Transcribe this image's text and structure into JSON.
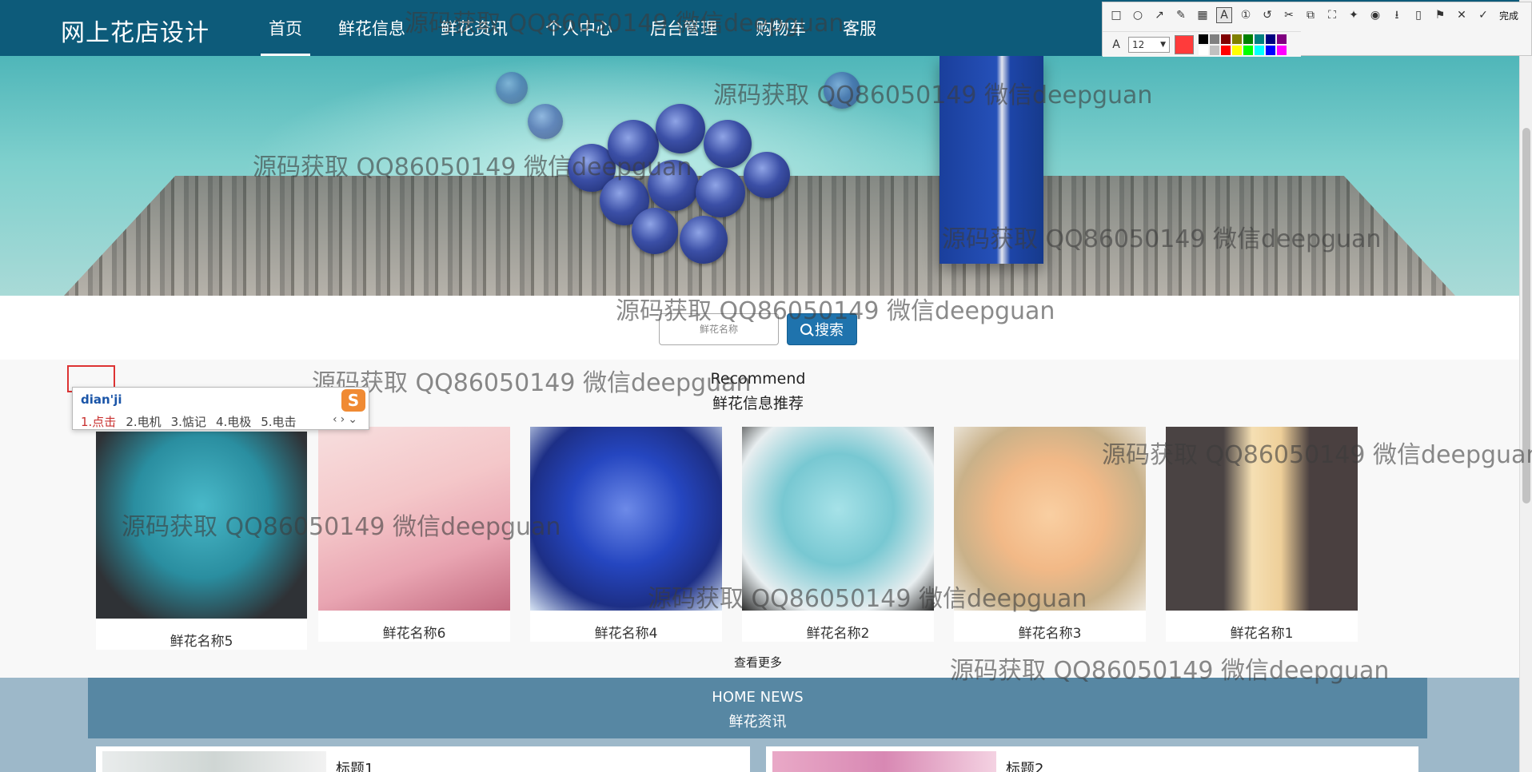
{
  "brand": "网上花店设计",
  "nav": [
    {
      "label": "首页",
      "active": true
    },
    {
      "label": "鲜花信息"
    },
    {
      "label": "鲜花资讯"
    },
    {
      "label": "个人中心"
    },
    {
      "label": "后台管理"
    },
    {
      "label": "购物车"
    },
    {
      "label": "客服"
    }
  ],
  "search": {
    "placeholder": "鲜花名称",
    "button_label": "搜索"
  },
  "recommend": {
    "title_en": "Recommend",
    "title_cn": "鲜花信息推荐",
    "items": [
      {
        "name": "鲜花名称5",
        "palette": [
          "#3aa6b9",
          "#46464a"
        ]
      },
      {
        "name": "鲜花名称6",
        "palette": [
          "#f0c8c8",
          "#d86a85"
        ]
      },
      {
        "name": "鲜花名称4",
        "palette": [
          "#2241b5",
          "#6c86e3"
        ]
      },
      {
        "name": "鲜花名称2",
        "palette": [
          "#8fd6dd",
          "#f2f2f2"
        ]
      },
      {
        "name": "鲜花名称3",
        "palette": [
          "#f6c79a",
          "#c8ae7f"
        ]
      },
      {
        "name": "鲜花名称1",
        "palette": [
          "#f2d7a8",
          "#4a4040"
        ]
      }
    ],
    "more_label": "查看更多"
  },
  "news": {
    "title_en": "HOME NEWS",
    "title_cn": "鲜花资讯",
    "items": [
      {
        "title": "标题1"
      },
      {
        "title": "标题2"
      }
    ]
  },
  "watermark": "源码获取 QQ86050149 微信deepguan",
  "ime": {
    "pinyin": "dian'ji",
    "logo": "S",
    "candidates": [
      "1.点击",
      "2.电机",
      "3.惦记",
      "4.电极",
      "5.电击"
    ]
  },
  "snip_toolbar": {
    "tools": [
      "rect-icon",
      "ellipse-icon",
      "arrow-icon",
      "pen-icon",
      "mosaic-icon",
      "text-icon",
      "number-icon",
      "undo-icon",
      "redo-icon",
      "pin-icon",
      "copy-icon",
      "ocr-icon",
      "record-icon",
      "save-icon",
      "phone-icon",
      "bookmark-icon",
      "close-icon"
    ],
    "done_label": "完成",
    "font_size": "12",
    "current_color": "#ff3b3b",
    "palette": [
      "#000000",
      "#808080",
      "#800000",
      "#808000",
      "#008000",
      "#008080",
      "#000080",
      "#800080",
      "#ffffff",
      "#c0c0c0",
      "#ff0000",
      "#ffff00",
      "#00ff00",
      "#00ffff",
      "#0000ff",
      "#ff00ff"
    ]
  },
  "colors": {
    "nav_bg": "#0d5b7a",
    "search_btn": "#1f73ad",
    "news_head": "#5787a3",
    "news_bg": "#9db8c9"
  }
}
